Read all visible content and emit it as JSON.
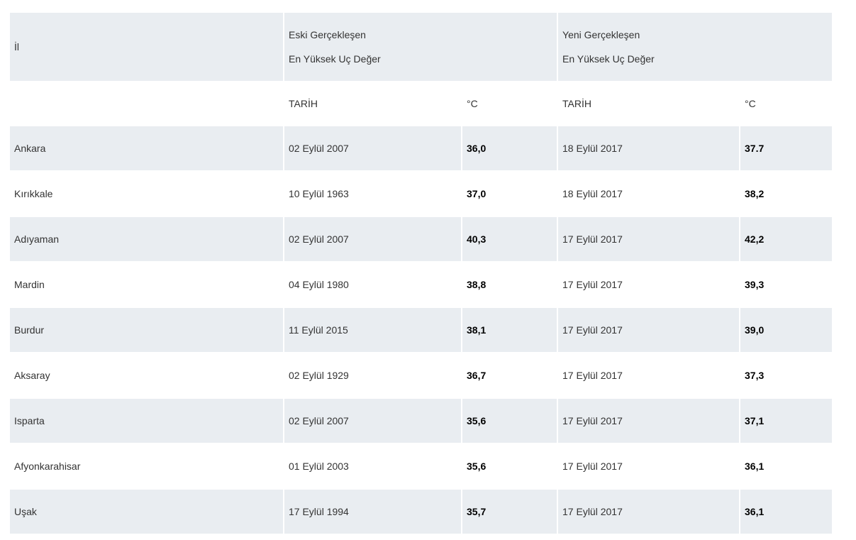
{
  "header": {
    "il": "İl",
    "old_group_line1": "Eski Gerçekleşen",
    "old_group_line2": "En Yüksek Uç Değer",
    "new_group_line1": "Yeni Gerçekleşen",
    "new_group_line2": "En Yüksek Uç Değer",
    "date_label": "TARİH",
    "unit_label": "°C"
  },
  "rows": [
    {
      "il": "Ankara",
      "old_date": "02 Eylül 2007",
      "old_temp": "36,0",
      "new_date": "18 Eylül 2017",
      "new_temp": "37.7"
    },
    {
      "il": "Kırıkkale",
      "old_date": "10 Eylül 1963",
      "old_temp": "37,0",
      "new_date": "18 Eylül 2017",
      "new_temp": "38,2"
    },
    {
      "il": "Adıyaman",
      "old_date": "02 Eylül 2007",
      "old_temp": "40,3",
      "new_date": "17 Eylül 2017",
      "new_temp": "42,2"
    },
    {
      "il": "Mardin",
      "old_date": "04 Eylül 1980",
      "old_temp": "38,8",
      "new_date": "17 Eylül 2017",
      "new_temp": "39,3"
    },
    {
      "il": "Burdur",
      "old_date": "11 Eylül 2015",
      "old_temp": "38,1",
      "new_date": "17 Eylül 2017",
      "new_temp": "39,0"
    },
    {
      "il": "Aksaray",
      "old_date": "02 Eylül 1929",
      "old_temp": "36,7",
      "new_date": "17 Eylül 2017",
      "new_temp": "37,3"
    },
    {
      "il": "Isparta",
      "old_date": "02 Eylül 2007",
      "old_temp": "35,6",
      "new_date": "17 Eylül 2017",
      "new_temp": "37,1"
    },
    {
      "il": "Afyonkarahisar",
      "old_date": "01 Eylül 2003",
      "old_temp": "35,6",
      "new_date": "17 Eylül 2017",
      "new_temp": "36,1"
    },
    {
      "il": "Uşak",
      "old_date": "17 Eylül 1994",
      "old_temp": "35,7",
      "new_date": "17 Eylül 2017",
      "new_temp": "36,1"
    }
  ]
}
